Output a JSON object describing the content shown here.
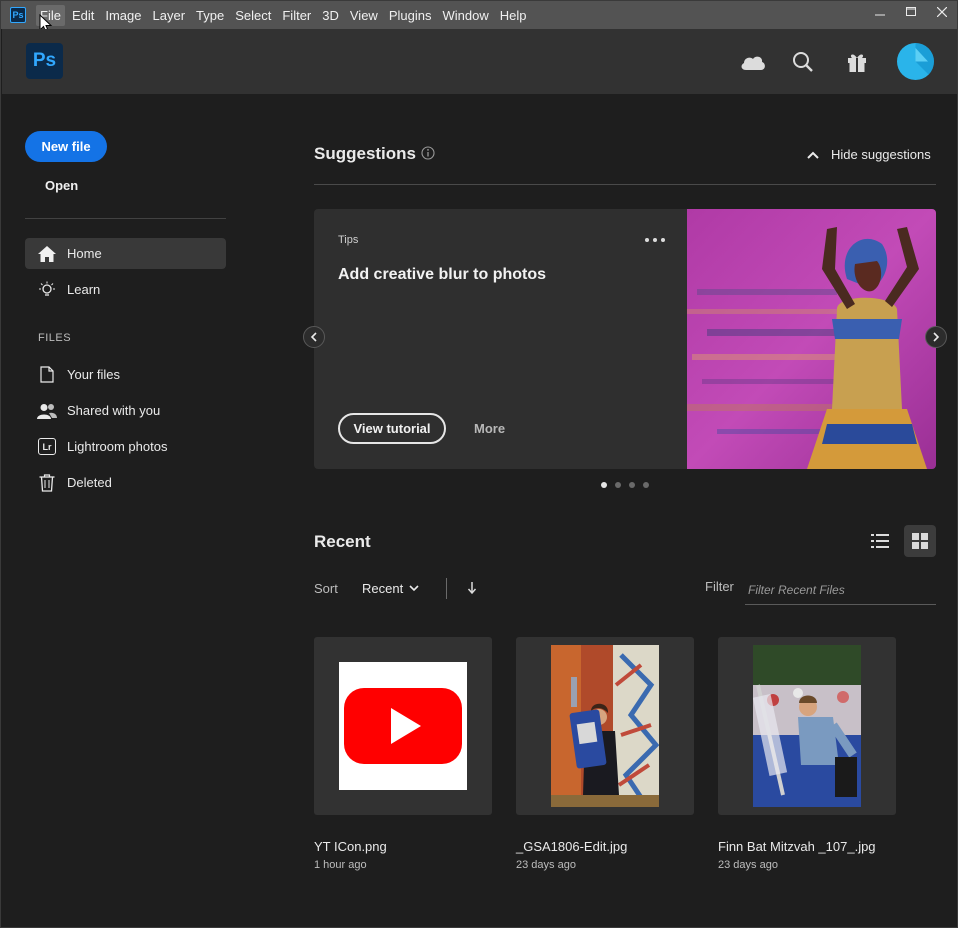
{
  "menubar": {
    "app_icon_text": "Ps",
    "items": [
      "File",
      "Edit",
      "Image",
      "Layer",
      "Type",
      "Select",
      "Filter",
      "3D",
      "View",
      "Plugins",
      "Window",
      "Help"
    ],
    "active_item": "File"
  },
  "header": {
    "logo_text": "Ps",
    "icons": [
      "cloud-icon",
      "search-icon",
      "gift-icon",
      "avatar"
    ]
  },
  "sidebar": {
    "new_file_label": "New file",
    "open_label": "Open",
    "items": [
      {
        "label": "Home",
        "icon": "home-icon",
        "selected": true
      },
      {
        "label": "Learn",
        "icon": "lightbulb-icon",
        "selected": false
      }
    ],
    "files_section_label": "FILES",
    "file_items": [
      {
        "label": "Your files",
        "icon": "document-icon"
      },
      {
        "label": "Shared with you",
        "icon": "people-icon"
      },
      {
        "label": "Lightroom photos",
        "icon": "lightroom-icon",
        "icon_text": "Lr"
      },
      {
        "label": "Deleted",
        "icon": "trash-icon"
      }
    ]
  },
  "suggestions": {
    "title": "Suggestions",
    "hide_label": "Hide suggestions",
    "card": {
      "label": "Tips",
      "title": "Add creative blur to photos",
      "primary_button": "View tutorial",
      "secondary_button": "More"
    },
    "page_count": 4,
    "active_page": 1
  },
  "recent": {
    "title": "Recent",
    "sort_label": "Sort",
    "sort_value": "Recent",
    "filter_label": "Filter",
    "filter_placeholder": "Filter Recent Files",
    "files": [
      {
        "name": "YT ICon.png",
        "time": "1 hour ago"
      },
      {
        "name": "_GSA1806-Edit.jpg",
        "time": "23 days ago"
      },
      {
        "name": "Finn Bat Mitzvah _107_.jpg",
        "time": "23 days ago"
      }
    ]
  },
  "colors": {
    "accent": "#1473e6",
    "ps_blue": "#31a8ff",
    "background": "#1e1e1e",
    "header": "#323232",
    "menubar": "#535353"
  }
}
